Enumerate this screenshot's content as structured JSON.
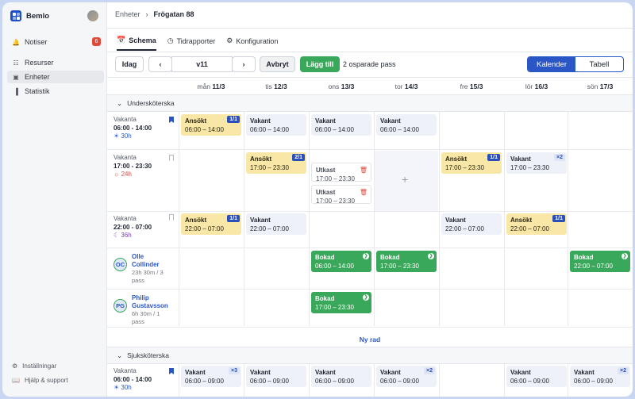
{
  "app": {
    "name": "Bemlo"
  },
  "sidebar": {
    "items": [
      {
        "label": "Notiser",
        "icon": "bell-icon",
        "badge": "6"
      },
      {
        "label": "Resurser",
        "icon": "people-icon"
      },
      {
        "label": "Enheter",
        "icon": "building-icon",
        "active": true
      },
      {
        "label": "Statistik",
        "icon": "chart-icon"
      }
    ],
    "footer": [
      {
        "label": "Inställningar",
        "icon": "gear-icon"
      },
      {
        "label": "Hjälp & support",
        "icon": "book-icon"
      }
    ]
  },
  "breadcrumb": {
    "parent": "Enheter",
    "current": "Frögatan 88"
  },
  "tabs": [
    {
      "label": "Schema",
      "icon": "calendar-icon",
      "active": true
    },
    {
      "label": "Tidrapporter",
      "icon": "clock-icon"
    },
    {
      "label": "Konfiguration",
      "icon": "gear-icon"
    }
  ],
  "toolbar": {
    "today": "Idag",
    "week": "v11",
    "cancel": "Avbryt",
    "add": "Lägg till",
    "saved": "2 osparade pass",
    "view_calendar": "Kalender",
    "view_table": "Tabell"
  },
  "days": [
    {
      "name": "mån",
      "date": "11/3"
    },
    {
      "name": "tis",
      "date": "12/3"
    },
    {
      "name": "ons",
      "date": "13/3"
    },
    {
      "name": "tor",
      "date": "14/3"
    },
    {
      "name": "fre",
      "date": "15/3"
    },
    {
      "name": "lör",
      "date": "16/3"
    },
    {
      "name": "sön",
      "date": "17/3"
    }
  ],
  "sections": {
    "first": "Undersköterska",
    "second": "Sjuksköterska"
  },
  "rows": [
    {
      "status": "Vakanta",
      "time": "06:00 - 14:00",
      "hours": "30h",
      "hours_icon": "sun-icon"
    },
    {
      "status": "Vakanta",
      "time": "17:00 - 23:30",
      "hours": "24h",
      "hours_icon": "sunset-icon"
    },
    {
      "status": "Vakanta",
      "time": "22:00 - 07:00",
      "hours": "36h",
      "hours_icon": "moon-icon"
    },
    {
      "person_initials": "OC",
      "person_first": "Olle",
      "person_last": "Collinder",
      "person_info": "23h 30m / 3",
      "person_info2": "pass"
    },
    {
      "person_initials": "PG",
      "person_first": "Philip",
      "person_last": "Gustavsson",
      "person_info": "6h 30m / 1",
      "person_info2": "pass"
    },
    {
      "status": "Vakanta",
      "time": "06:00 - 14:00",
      "hours": "30h",
      "hours_icon": "sun-icon"
    }
  ],
  "new_row": "Ny rad",
  "shifts": {
    "r1": [
      {
        "kind": "Ansökt",
        "time": "06:00 – 14:00",
        "tag": "1/1"
      },
      {
        "kind": "Vakant",
        "time": "06:00 – 14:00"
      },
      {
        "kind": "Vakant",
        "time": "06:00 – 14:00"
      },
      {
        "kind": "Vakant",
        "time": "06:00 – 14:00"
      }
    ],
    "r2": [
      {
        "kind": "Ansökt",
        "time": "17:00 – 23:30",
        "tag": "2/1"
      },
      {
        "kind": "Utkast",
        "time": "17:00 – 23:30"
      },
      {
        "kind": "Utkast",
        "time": "17:00 – 23:30"
      },
      {
        "kind": "Ansökt",
        "time": "17:00 – 23:30",
        "tag": "1/1"
      },
      {
        "kind": "Vakant",
        "time": "17:00 – 23:30",
        "tag": "×2"
      }
    ],
    "r3": [
      {
        "kind": "Ansökt",
        "time": "22:00 – 07:00",
        "tag": "1/1"
      },
      {
        "kind": "Vakant",
        "time": "22:00 – 07:00"
      },
      {
        "kind": "Vakant",
        "time": "22:00 – 07:00"
      },
      {
        "kind": "Ansökt",
        "time": "22:00 – 07:00",
        "tag": "1/1"
      }
    ],
    "r4": [
      {
        "kind": "Bokad",
        "time": "06:00 – 14:00"
      },
      {
        "kind": "Bokad",
        "time": "17:00 – 23:30"
      },
      {
        "kind": "Bokad",
        "time": "22:00 – 07:00"
      }
    ],
    "r5": [
      {
        "kind": "Bokad",
        "time": "17:00 – 23:30"
      }
    ],
    "r6": [
      {
        "kind": "Vakant",
        "time": "06:00 – 09:00",
        "tag": "×3"
      },
      {
        "kind": "Vakant",
        "time": "06:00 – 09:00"
      },
      {
        "kind": "Vakant",
        "time": "06:00 – 09:00"
      },
      {
        "kind": "Vakant",
        "time": "06:00 – 09:00",
        "tag": "×2"
      },
      {
        "kind": "Vakant",
        "time": "06:00 – 09:00"
      },
      {
        "kind": "Vakant",
        "time": "06:00 – 09:00",
        "tag": "×2"
      }
    ]
  }
}
